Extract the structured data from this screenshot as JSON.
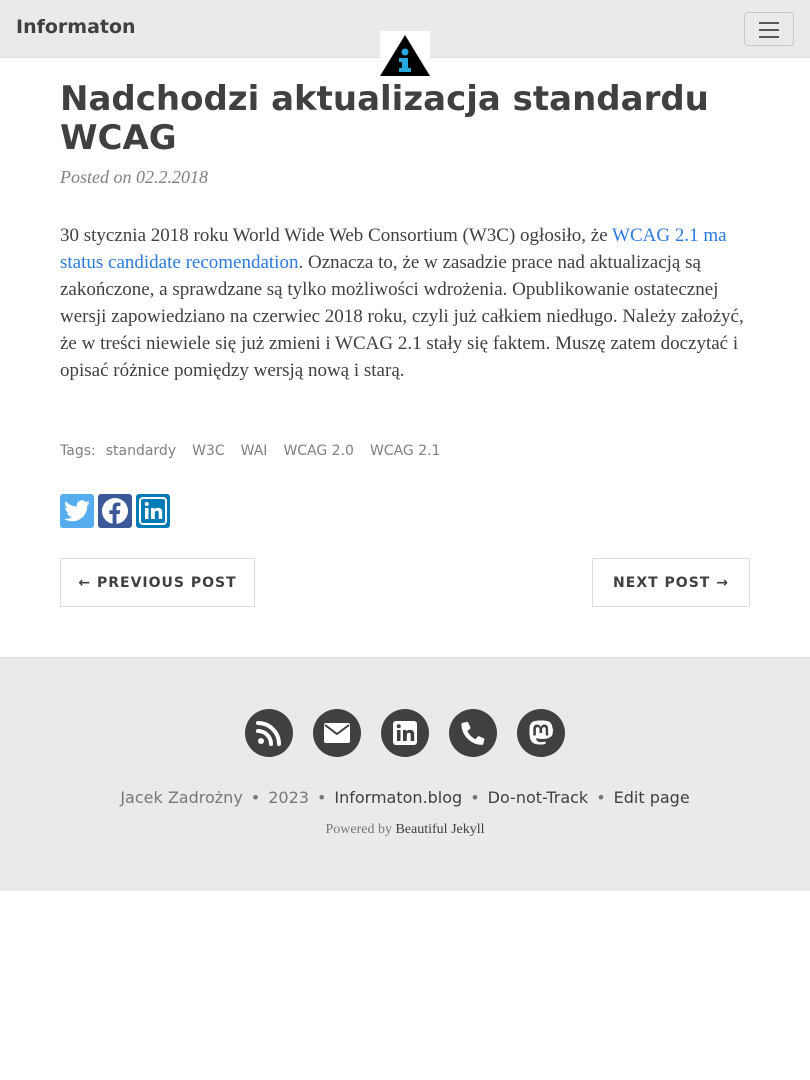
{
  "navbar": {
    "brand": "Informaton",
    "menu_icon": "hamburger-menu-icon",
    "avatar_icon": "information-logo-icon"
  },
  "post": {
    "title": "Nadchodzi aktualizacja standardu WCAG",
    "meta": "Posted on 02.2.2018",
    "body_before_link": "30 stycznia 2018 roku World Wide Web Consortium (W3C) ogłosiło, że ",
    "body_link": "WCAG 2.1 ma status candidate recomendation",
    "body_after_link": ". Oznacza to, że w zasadzie prace nad aktualizacją są zakończone, a sprawdzane są tylko możliwości wdrożenia. Opublikowanie ostatecznej wersji zapowiedziano na czerwiec 2018 roku, czyli już całkiem niedługo. Należy założyć, że w treści niewiele się już zmieni i WCAG 2.1 stały się faktem. Muszę zatem doczytać i opisać różnice pomiędzy wersją nową i starą."
  },
  "tags": {
    "label": "Tags:",
    "items": [
      "standardy",
      "W3C",
      "WAI",
      "WCAG 2.0",
      "WCAG 2.1"
    ]
  },
  "share": {
    "icons": [
      "twitter-icon",
      "facebook-icon",
      "linkedin-icon"
    ],
    "colors": {
      "twitter": "#55acee",
      "facebook": "#3b5998",
      "linkedin": "#007bb5"
    }
  },
  "pager": {
    "previous": "← PREVIOUS POST",
    "next": "NEXT POST →"
  },
  "footer": {
    "icons": [
      "rss-icon",
      "envelope-icon",
      "linkedin-icon",
      "phone-icon",
      "mastodon-icon"
    ],
    "author": "Jacek Zadrożny",
    "year": "2023",
    "site": "Informaton.blog",
    "dnt": "Do-not-Track",
    "edit": "Edit page",
    "powered_prefix": "Powered by",
    "powered_link": "Beautiful Jekyll",
    "separator": "•"
  },
  "colors": {
    "navbar_bg": "#eaeaea",
    "link": "#2a7ae2",
    "text": "#404040"
  }
}
